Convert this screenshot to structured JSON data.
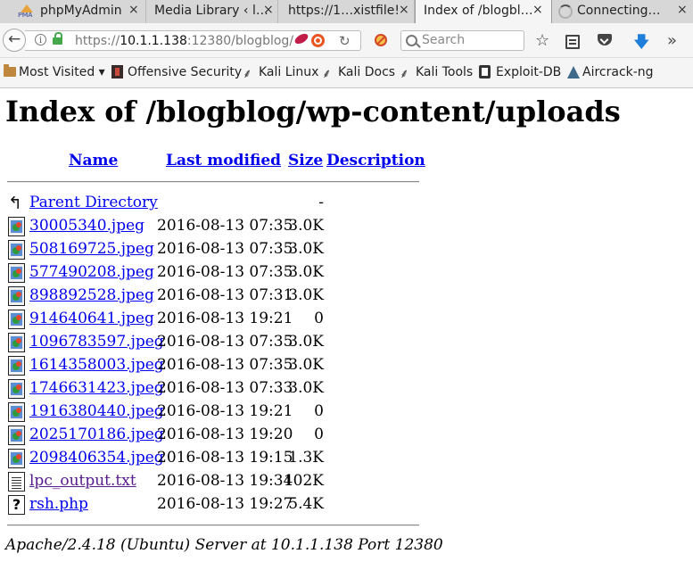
{
  "tabs": [
    {
      "title": "phpMyAdmin",
      "close": "×"
    },
    {
      "title": "Media Library ‹ l…",
      "close": "×"
    },
    {
      "title": "https://1…xistfile!",
      "close": "×"
    },
    {
      "title": "Index of /blogbl…",
      "close": "×"
    },
    {
      "title": "Connecting…",
      "close": "×"
    }
  ],
  "nav": {
    "back": "←",
    "info": "i",
    "url_host": "10.1.1.138",
    "url_rest": ":12380/blogblog/",
    "url_prefix": "https://",
    "reload": "↻",
    "search_placeholder": "Search",
    "star": "☆",
    "download": "🡇",
    "overflow": "»"
  },
  "bookmarks": [
    "Most Visited ▾",
    "Offensive Security",
    "Kali Linux",
    "Kali Docs",
    "Kali Tools",
    "Exploit-DB",
    "Aircrack-ng"
  ],
  "page": {
    "heading": "Index of /blogblog/wp-content/uploads",
    "columns": {
      "name": "Name",
      "modified": "Last modified",
      "size": "Size",
      "description": "Description"
    },
    "parent": {
      "name": "Parent Directory",
      "size": "-"
    },
    "files": [
      {
        "name": "30005340.jpeg",
        "modified": "2016-08-13 07:35",
        "size": "3.0K",
        "icon": "image-icon"
      },
      {
        "name": "508169725.jpeg",
        "modified": "2016-08-13 07:35",
        "size": "3.0K",
        "icon": "image-icon"
      },
      {
        "name": "577490208.jpeg",
        "modified": "2016-08-13 07:35",
        "size": "3.0K",
        "icon": "image-icon"
      },
      {
        "name": "898892528.jpeg",
        "modified": "2016-08-13 07:31",
        "size": "3.0K",
        "icon": "image-icon"
      },
      {
        "name": "914640641.jpeg",
        "modified": "2016-08-13 19:21",
        "size": "0",
        "icon": "image-icon"
      },
      {
        "name": "1096783597.jpeg",
        "modified": "2016-08-13 07:35",
        "size": "3.0K",
        "icon": "image-icon"
      },
      {
        "name": "1614358003.jpeg",
        "modified": "2016-08-13 07:35",
        "size": "3.0K",
        "icon": "image-icon"
      },
      {
        "name": "1746631423.jpeg",
        "modified": "2016-08-13 07:33",
        "size": "3.0K",
        "icon": "image-icon"
      },
      {
        "name": "1916380440.jpeg",
        "modified": "2016-08-13 19:21",
        "size": "0",
        "icon": "image-icon"
      },
      {
        "name": "2025170186.jpeg",
        "modified": "2016-08-13 19:20",
        "size": "0",
        "icon": "image-icon"
      },
      {
        "name": "2098406354.jpeg",
        "modified": "2016-08-13 19:15",
        "size": "1.3K",
        "icon": "image-icon"
      },
      {
        "name": "lpc_output.txt",
        "modified": "2016-08-13 19:34",
        "size": "102K",
        "icon": "text-file-icon",
        "visited": true
      },
      {
        "name": "rsh.php",
        "modified": "2016-08-13 19:27",
        "size": "5.4K",
        "icon": "unknown-file-icon"
      }
    ],
    "address": "Apache/2.4.18 (Ubuntu) Server at 10.1.1.138 Port 12380"
  }
}
